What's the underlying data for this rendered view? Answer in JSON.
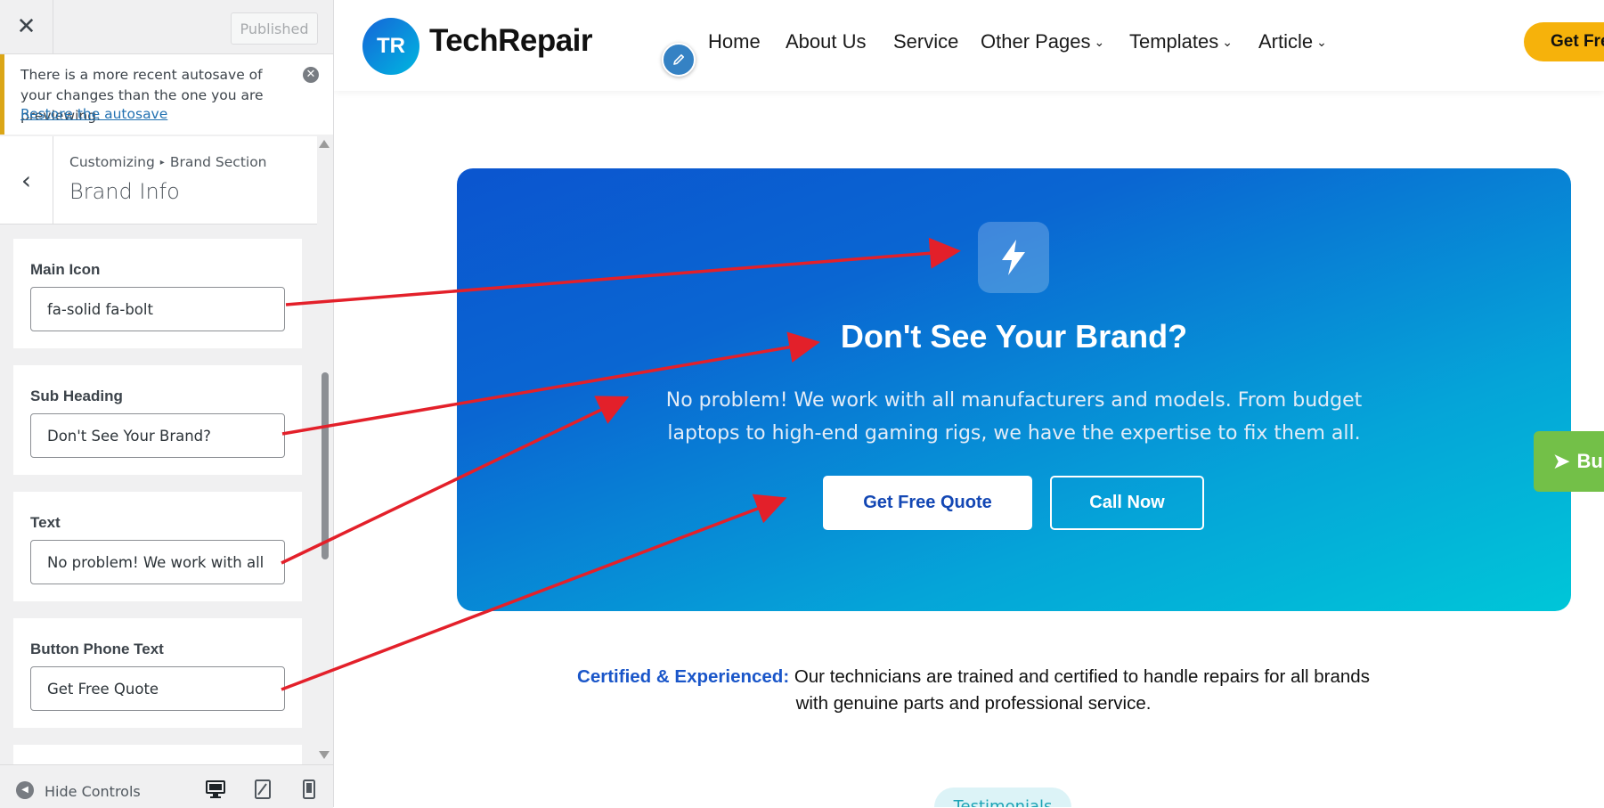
{
  "sidebar": {
    "close_icon": "close-icon",
    "published_label": "Published",
    "notice": {
      "text": "There is a more recent autosave of your changes than the one you are previewing.",
      "link": "Restore the autosave"
    },
    "breadcrumb": {
      "root": "Customizing",
      "separator": "▸",
      "section": "Brand Section"
    },
    "section_title": "Brand Info",
    "controls": [
      {
        "label": "Main Icon",
        "value": "fa-solid fa-bolt"
      },
      {
        "label": "Sub Heading",
        "value": "Don't See Your Brand?"
      },
      {
        "label": "Text",
        "value": "No problem! We work with all m"
      },
      {
        "label": "Button Phone Text",
        "value": "Get Free Quote"
      }
    ],
    "footer": {
      "hide_label": "Hide Controls"
    }
  },
  "preview": {
    "logo_badge": "TR",
    "logo_text": "TechRepair",
    "nav": [
      "Home",
      "About Us",
      "Service",
      "Other Pages",
      "Templates",
      "Article"
    ],
    "cta": "Get Fre",
    "hero": {
      "heading": "Don't See Your Brand?",
      "text": "No problem! We work with all manufacturers and models. From budget laptops to high-end gaming rigs, we have the expertise to fix them all.",
      "button_quote": "Get Free Quote",
      "button_call": "Call Now"
    },
    "side_tab": "Bu",
    "cert_strong": "Certified & Experienced:",
    "cert_text": " Our technicians are trained and certified to handle repairs for all brands with genuine parts and professional service.",
    "pill": "Testimonials"
  },
  "colors": {
    "accent": "#2271b1",
    "notice_border": "#dba617",
    "hero_start": "#0b55cf",
    "hero_end": "#00c6d8",
    "cta": "#f6b20b",
    "annotation_arrow": "#e3202a"
  }
}
